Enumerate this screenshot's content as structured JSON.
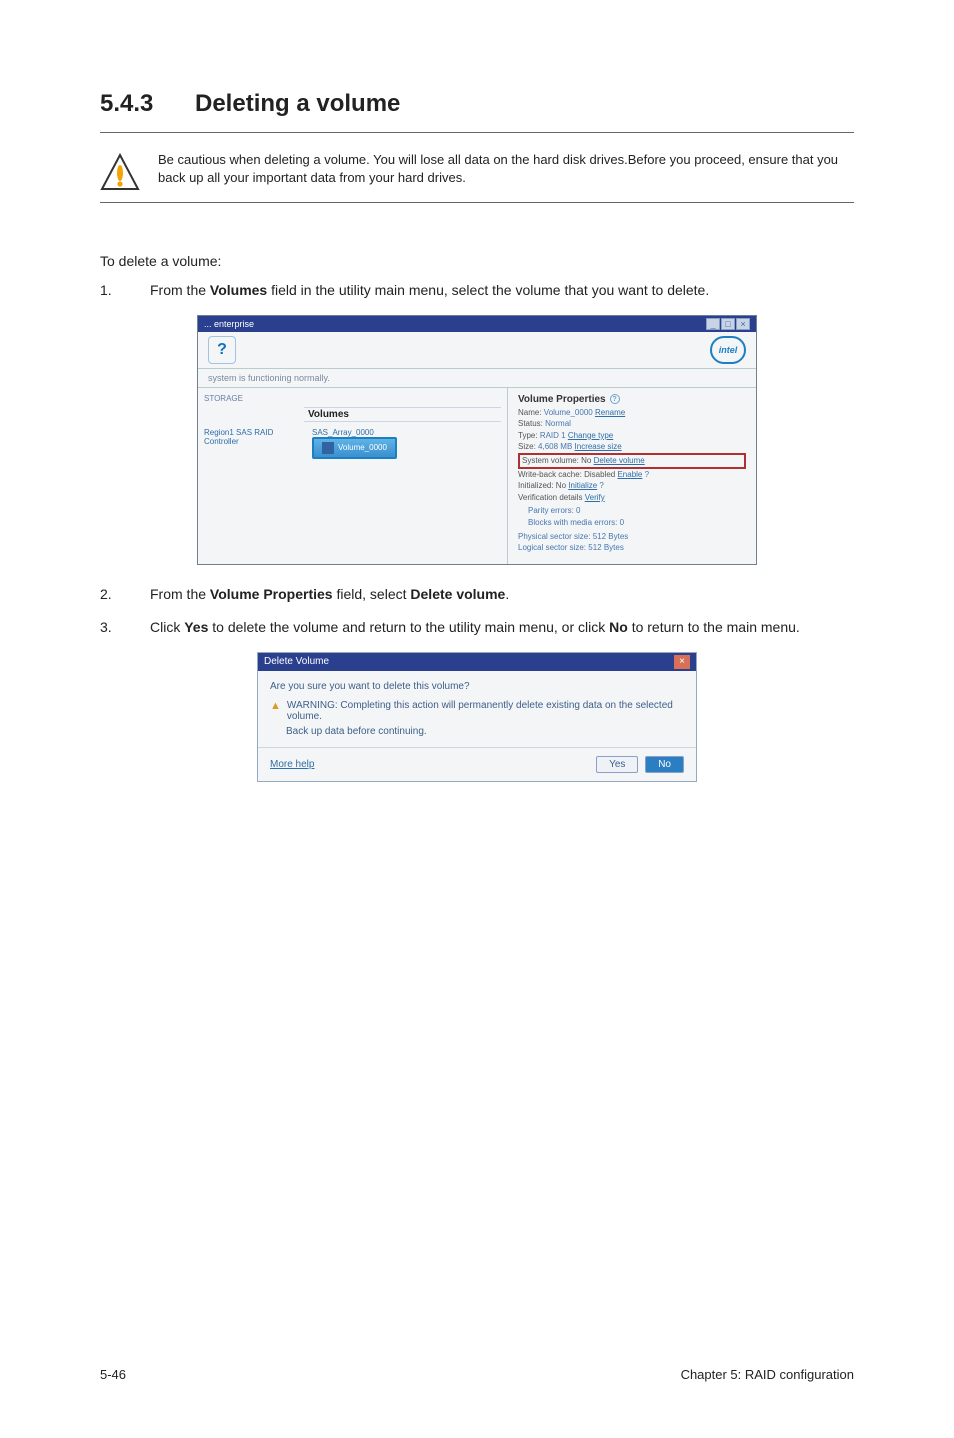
{
  "heading": {
    "number": "5.4.3",
    "title": "Deleting a volume"
  },
  "caution": "Be cautious when deleting a volume. You will lose all data on the hard disk drives.Before you proceed, ensure that you back up all your important data from your hard drives.",
  "intro": "To delete a volume:",
  "steps": {
    "s1": {
      "n": "1.",
      "pre": "From the ",
      "b1": "Volumes",
      "post1": " field in the utility main menu, select the volume that you want to delete."
    },
    "s2": {
      "n": "2.",
      "pre": "From the ",
      "b1": "Volume Properties",
      "mid": " field, select ",
      "b2": "Delete volume",
      "post": "."
    },
    "s3": {
      "n": "3.",
      "pre": "Click ",
      "b1": "Yes",
      "mid1": " to delete the volume and return to the utility main menu, or click ",
      "b2": "No",
      "mid2": " to return to the main menu."
    }
  },
  "shot1": {
    "titlebar": "... enterprise",
    "topicon_glyph": "?",
    "intel_label": "intel",
    "status": "system is functioning normally.",
    "storage_label": "STORAGE",
    "volumes_header": "Volumes",
    "controller_label": "Region1 SAS RAID Controller",
    "array_label": "SAS_Array_0000",
    "volume_chip": "Volume_0000",
    "props": {
      "header": "Volume Properties",
      "name_label": "Name:",
      "name_val": "Volume_0000",
      "name_link": "Rename",
      "status_label": "Status:",
      "status_val": "Normal",
      "type_label": "Type:",
      "type_val": "RAID 1",
      "type_link": "Change type",
      "size_label": "Size:",
      "size_val": "4,608 MB",
      "size_link": "Increase size",
      "sysvol_label": "System volume: No",
      "sysvol_link": "Delete volume",
      "wbc_label": "Write-back cache: Disabled",
      "wbc_link": "Enable",
      "init_label": "Initialized: No",
      "init_link": "Initialize",
      "verify_label": "Verification details",
      "verify_link": "Verify",
      "parity_label": "Parity errors: 0",
      "blocks_label": "Blocks with media errors: 0",
      "phys_label": "Physical sector size: 512 Bytes",
      "log_label": "Logical sector size: 512 Bytes"
    }
  },
  "shot2": {
    "title": "Delete Volume",
    "question": "Are you sure you want to delete this volume?",
    "warning": "WARNING: Completing this action will permanently delete existing data on the selected volume.",
    "backup": "Back up data before continuing.",
    "more_help": "More help",
    "yes": "Yes",
    "no": "No"
  },
  "footer": {
    "left": "5-46",
    "right": "Chapter 5: RAID configuration"
  }
}
